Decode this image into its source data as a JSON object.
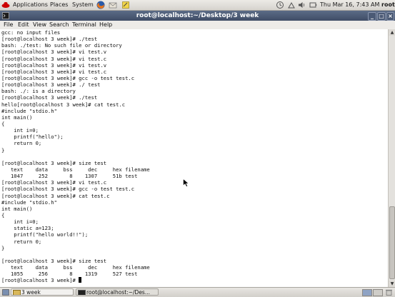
{
  "top_panel": {
    "applications": "Applications",
    "places": "Places",
    "system": "System",
    "datetime": "Thu Mar 16,  7:43 AM",
    "user": "root"
  },
  "window": {
    "title": "root@localhost:~/Desktop/3 week"
  },
  "menu": [
    "File",
    "Edit",
    "View",
    "Search",
    "Terminal",
    "Help"
  ],
  "terminal": {
    "lines": [
      "gcc: no input files",
      "[root@localhost 3 week]# ./test",
      "bash: ./test: No such file or directory",
      "[root@localhost 3 week]# vi test.v",
      "[root@localhost 3 week]# vi test.c",
      "[root@localhost 3 week]# vi test.v",
      "[root@localhost 3 week]# vi test.c",
      "[root@localhost 3 week]# gcc -o test test.c",
      "[root@localhost 3 week]# ./ test",
      "bash: ./: is a directory",
      "[root@localhost 3 week]# ./test",
      "hello[root@localhost 3 week]# cat test.c",
      "#include \"stdio.h\"",
      "int main()",
      "{",
      "    int i=0;",
      "    printf(\"hello\");",
      "    return 0;",
      "}",
      "",
      "[root@localhost 3 week]# size test",
      "   text    data     bss     dec     hex filename",
      "   1047     252       8    1307     51b test",
      "[root@localhost 3 week]# vi test.c",
      "[root@localhost 3 week]# gcc -o test test.c",
      "[root@localhost 3 week]# cat test.c",
      "#include \"stdio.h\"",
      "int main()",
      "{",
      "    int i=0;",
      "    static a=123;",
      "    printf(\"hello world!!\");",
      "    return 0;",
      "}",
      "",
      "[root@localhost 3 week]# size test",
      "   text    data     bss     dec     hex filename",
      "   1055     256       8    1319     527 test"
    ],
    "prompt": "[root@localhost 3 week]# "
  },
  "taskbar": {
    "tasks": [
      "3 week",
      "root@localhost:~/Des..."
    ]
  }
}
